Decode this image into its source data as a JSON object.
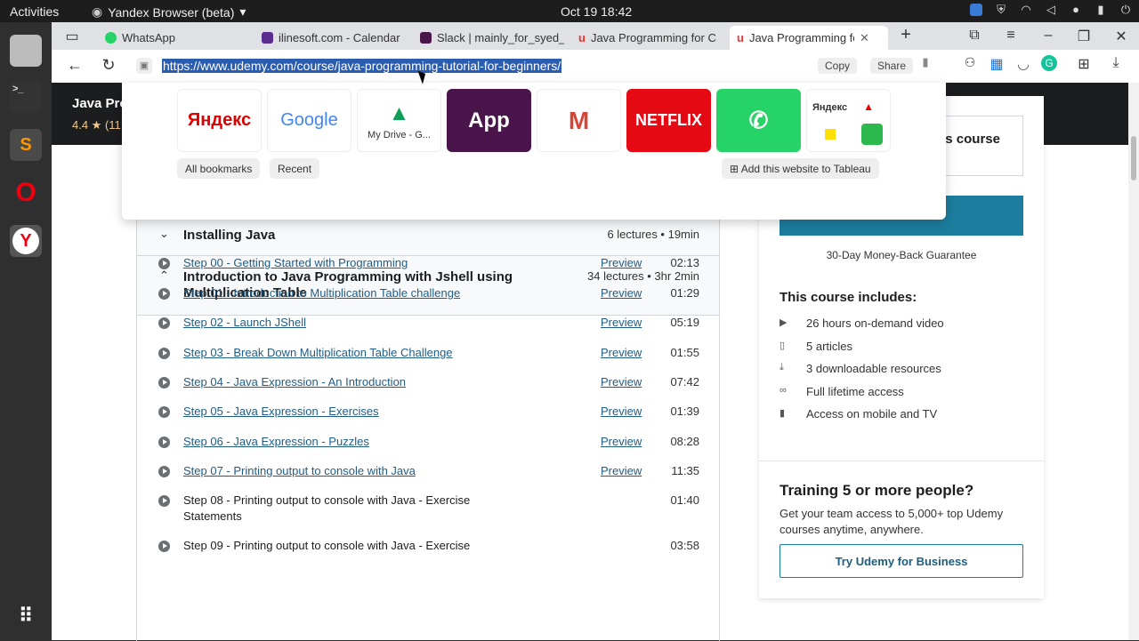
{
  "topbar": {
    "activities": "Activities",
    "app": "Yandex Browser (beta)",
    "clock": "Oct 19  18:42"
  },
  "tabs": [
    {
      "label": "WhatsApp",
      "color": "#25d366"
    },
    {
      "label": "ilinesoft.com - Calendar",
      "color": "#5c2d91"
    },
    {
      "label": "Slack | mainly_for_syed_",
      "color": "#4a154b"
    },
    {
      "label": "Java Programming for C",
      "color": "#a435f0"
    },
    {
      "label": "Java Programming for",
      "color": "#a435f0"
    }
  ],
  "address": {
    "url": "https://www.udemy.com/course/java-programming-tutorial-for-beginners/",
    "copy": "Copy",
    "share": "Share"
  },
  "bookmarks": {
    "tiles": [
      {
        "label": "Яндекс",
        "color": "#d00"
      },
      {
        "label": "Google",
        "color": "#4285f4"
      },
      {
        "label": "My Drive - G...",
        "color": "#333"
      },
      {
        "label": "App",
        "color": "#fff"
      },
      {
        "label": "M",
        "color": "#d44638"
      },
      {
        "label": "NETFLIX",
        "color": "#fff"
      },
      {
        "label": "WhatsApp",
        "color": "#fff"
      },
      {
        "label": "Яндекс",
        "color": "#333"
      }
    ],
    "all": "All bookmarks",
    "recent": "Recent",
    "add": "Add this website to Tableau"
  },
  "hero": {
    "title": "Java Pro",
    "rating": "4.4 ★ (11"
  },
  "curriculum": {
    "sections": [
      {
        "title": "Installing Java",
        "meta": "6 lectures • 19min"
      },
      {
        "title": "Introduction to Java Programming with Jshell using Multiplication Table",
        "meta": "34 lectures • 3hr 2min"
      }
    ],
    "lectures": [
      {
        "title": "Step 00 - Getting Started with Programming",
        "preview": "Preview",
        "duration": "02:13"
      },
      {
        "title": "Step 01 - Introduction to Multiplication Table challenge",
        "preview": "Preview",
        "duration": "01:29"
      },
      {
        "title": "Step 02 - Launch JShell",
        "preview": "Preview",
        "duration": "05:19"
      },
      {
        "title": "Step 03 - Break Down Multiplication Table Challenge",
        "preview": "Preview",
        "duration": "01:55"
      },
      {
        "title": "Step 04 - Java Expression - An Introduction",
        "preview": "Preview",
        "duration": "07:42"
      },
      {
        "title": "Step 05 - Java Expression - Exercises",
        "preview": "Preview",
        "duration": "01:39"
      },
      {
        "title": "Step 06 - Java Expression - Puzzles",
        "preview": "Preview",
        "duration": "08:28"
      },
      {
        "title": "Step 07 - Printing output to console with Java",
        "preview": "Preview",
        "duration": "11:35"
      },
      {
        "title": "Step 08 - Printing output to console with Java - Exercise Statements",
        "preview": "",
        "duration": "01:40"
      },
      {
        "title": "Step 09 - Printing output to console with Java - Exercise",
        "preview": "",
        "duration": "03:58"
      }
    ]
  },
  "sidebar": {
    "partial_title": "s course",
    "guarantee": "30-Day Money-Back Guarantee",
    "includes_title": "This course includes:",
    "includes": [
      {
        "icon": "video-icon",
        "text": "26 hours on-demand video"
      },
      {
        "icon": "file-icon",
        "text": "5 articles"
      },
      {
        "icon": "download-icon",
        "text": "3 downloadable resources"
      },
      {
        "icon": "infinity-icon",
        "text": "Full lifetime access"
      },
      {
        "icon": "mobile-icon",
        "text": "Access on mobile and TV"
      }
    ],
    "training_title": "Training 5 or more people?",
    "training_text": "Get your team access to 5,000+ top Udemy courses anytime, anywhere.",
    "business_button": "Try Udemy for Business"
  }
}
